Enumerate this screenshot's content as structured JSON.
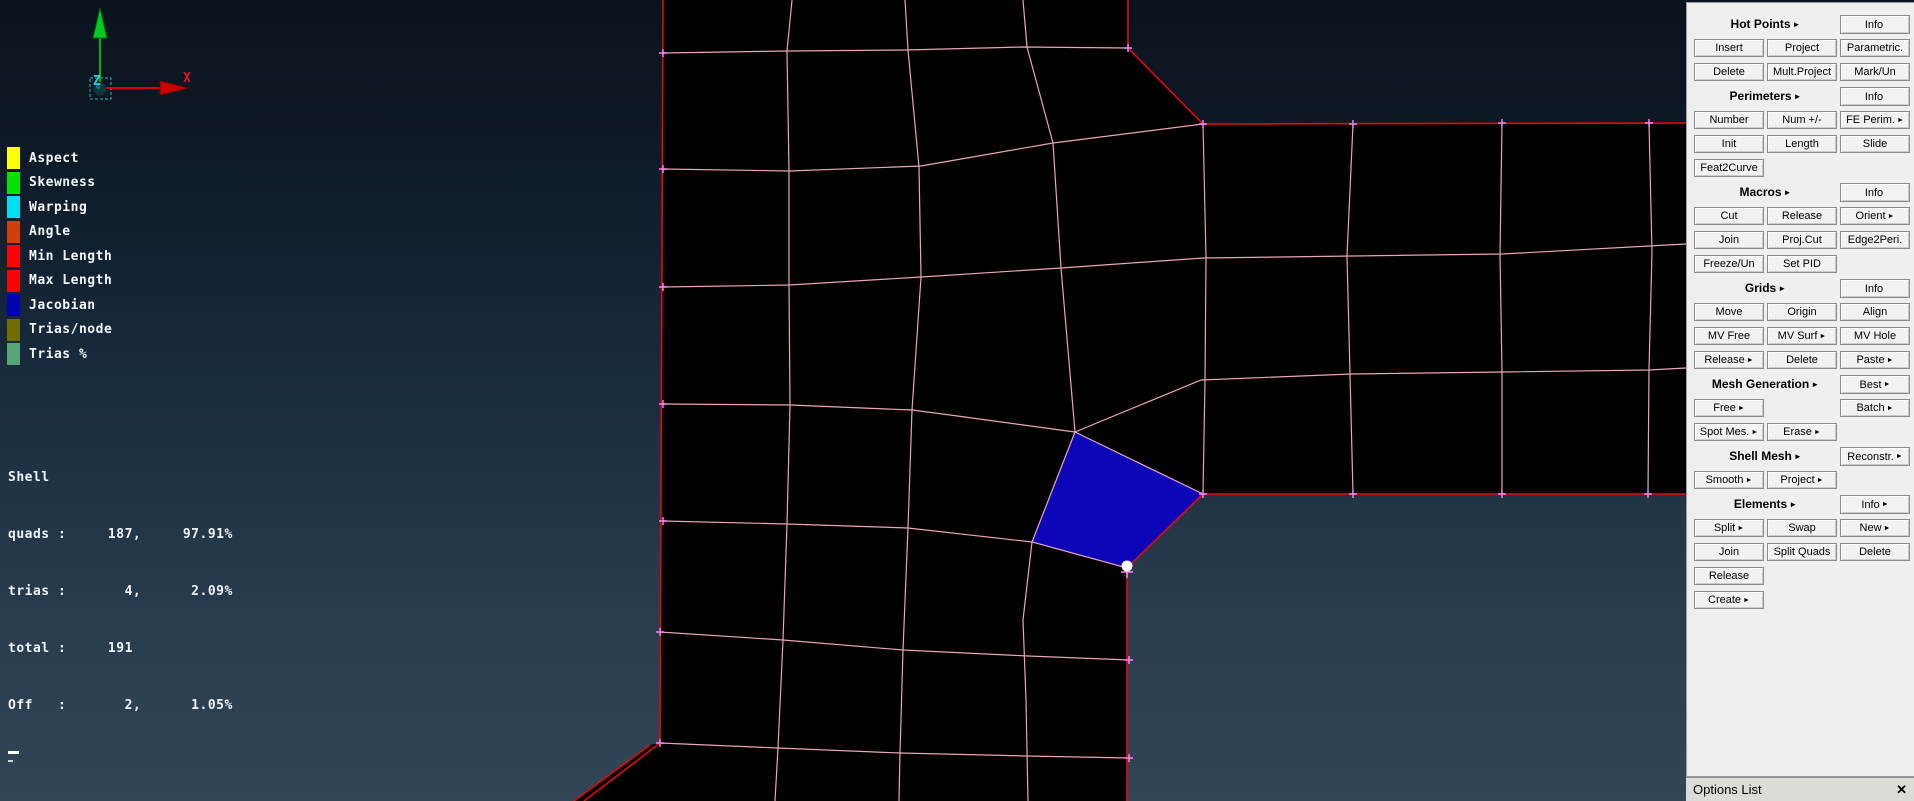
{
  "axis_triad": {
    "x_label": "X",
    "z_label": "Z"
  },
  "legend": {
    "items": [
      {
        "label": "Aspect",
        "color": "#ffff00"
      },
      {
        "label": "Skewness",
        "color": "#00e400"
      },
      {
        "label": "Warping",
        "color": "#00dff2"
      },
      {
        "label": "Angle",
        "color": "#d04008"
      },
      {
        "label": "Min Length",
        "color": "#fb0207"
      },
      {
        "label": "Max Length",
        "color": "#fb0207"
      },
      {
        "label": "Jacobian",
        "color": "#0202b2"
      },
      {
        "label": "Trias/node",
        "color": "#6e6e02"
      },
      {
        "label": "Trias %",
        "color": "#57a476"
      }
    ]
  },
  "stats": {
    "lines": [
      "Shell",
      "quads :     187,     97.91%",
      "trias :       4,      2.09%",
      "total :     191",
      "Off   :       2,      1.05%"
    ]
  },
  "viewport": {
    "highlight_color": "#0c06b8",
    "edge_color": "#eca4bc",
    "boundary_color": "#e60909",
    "node_color": "#ff86fa"
  },
  "panel": {
    "groups": [
      {
        "header": {
          "title": "Hot Points",
          "arrow": "►"
        },
        "info": {
          "label": "Info"
        },
        "rows": [
          [
            {
              "label": "Insert"
            },
            {
              "label": "Project"
            },
            {
              "label": "Parametric."
            }
          ],
          [
            {
              "label": "Delete"
            },
            {
              "label": "Mult.Project"
            },
            {
              "label": "Mark/Un"
            }
          ]
        ]
      },
      {
        "header": {
          "title": "Perimeters",
          "arrow": "►"
        },
        "info": {
          "label": "Info"
        },
        "rows": [
          [
            {
              "label": "Number"
            },
            {
              "label": "Num +/-"
            },
            {
              "label": "FE Perim.",
              "arrow": "►"
            }
          ],
          [
            {
              "label": "Init"
            },
            {
              "label": "Length"
            },
            {
              "label": "Slide"
            }
          ],
          [
            {
              "label": "Feat2Curve"
            }
          ]
        ]
      },
      {
        "header": {
          "title": "Macros",
          "arrow": "►"
        },
        "info": {
          "label": "Info"
        },
        "rows": [
          [
            {
              "label": "Cut"
            },
            {
              "label": "Release"
            },
            {
              "label": "Orient",
              "arrow": "►"
            }
          ],
          [
            {
              "label": "Join"
            },
            {
              "label": "Proj.Cut"
            },
            {
              "label": "Edge2Peri."
            }
          ],
          [
            {
              "label": "Freeze/Un"
            },
            {
              "label": "Set PID"
            }
          ]
        ]
      },
      {
        "header": {
          "title": "Grids",
          "arrow": "►"
        },
        "info": {
          "label": "Info"
        },
        "rows": [
          [
            {
              "label": "Move"
            },
            {
              "label": "Origin"
            },
            {
              "label": "Align"
            }
          ],
          [
            {
              "label": "MV Free"
            },
            {
              "label": "MV Surf",
              "arrow": "►"
            },
            {
              "label": "MV Hole"
            }
          ],
          [
            {
              "label": "Release",
              "arrow": "►"
            },
            {
              "label": "Delete"
            },
            {
              "label": "Paste",
              "arrow": "►"
            }
          ]
        ]
      },
      {
        "header": {
          "title": "Mesh Generation",
          "arrow": "►"
        },
        "info": {
          "label": "Best",
          "arrow": "►"
        },
        "rows": [
          [
            {
              "label": "Free",
              "arrow": "►"
            },
            {
              "label": "Batch",
              "arrow": "►"
            }
          ],
          [
            {
              "label": "Spot Mes.",
              "arrow": "►"
            },
            {
              "label": "Erase",
              "arrow": "►"
            }
          ]
        ]
      },
      {
        "header": {
          "title": "Shell Mesh",
          "arrow": "►"
        },
        "info": {
          "label": "Reconstr.",
          "arrow": "►"
        },
        "rows": [
          [
            {
              "label": "Smooth",
              "arrow": "►"
            },
            {
              "label": "Project",
              "arrow": "►"
            }
          ]
        ]
      },
      {
        "header": {
          "title": "Elements",
          "arrow": "►"
        },
        "info": {
          "label": "Info",
          "arrow": "►"
        },
        "rows": [
          [
            {
              "label": "Split",
              "arrow": "►"
            },
            {
              "label": "Swap"
            },
            {
              "label": "New",
              "arrow": "►"
            }
          ],
          [
            {
              "label": "Join"
            },
            {
              "label": "Split Quads"
            },
            {
              "label": "Delete"
            }
          ],
          [
            {
              "label": "Release"
            }
          ],
          [
            {
              "label": "Create",
              "arrow": "►"
            }
          ]
        ]
      }
    ]
  },
  "options_bar": {
    "label": "Options List",
    "close_icon": "✕"
  }
}
